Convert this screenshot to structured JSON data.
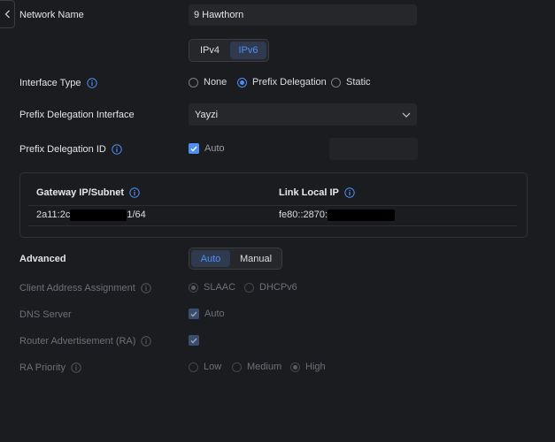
{
  "network_name": {
    "label": "Network Name",
    "value": "9 Hawthorn"
  },
  "ip_version": {
    "options": [
      "IPv4",
      "IPv6"
    ],
    "selected": "IPv6"
  },
  "interface_type": {
    "label": "Interface Type",
    "options": [
      "None",
      "Prefix Delegation",
      "Static"
    ],
    "selected": "Prefix Delegation"
  },
  "prefix_delegation_interface": {
    "label": "Prefix Delegation Interface",
    "value": "Yayzi"
  },
  "prefix_delegation_id": {
    "label": "Prefix Delegation ID",
    "auto_label": "Auto",
    "auto_checked": true,
    "value": ""
  },
  "status_table": {
    "gateway_header": "Gateway IP/Subnet",
    "link_local_header": "Link Local IP",
    "gateway_prefix": "2a11:2c",
    "gateway_suffix": "1/64",
    "link_local_prefix": "fe80::2870:"
  },
  "advanced": {
    "label": "Advanced",
    "options": [
      "Auto",
      "Manual"
    ],
    "selected": "Auto"
  },
  "client_address_assignment": {
    "label": "Client Address Assignment",
    "options": [
      "SLAAC",
      "DHCPv6"
    ],
    "selected": "SLAAC"
  },
  "dns_server": {
    "label": "DNS Server",
    "auto_label": "Auto",
    "checked": true
  },
  "router_advertisement": {
    "label": "Router Advertisement (RA)",
    "checked": true
  },
  "ra_priority": {
    "label": "RA Priority",
    "options": [
      "Low",
      "Medium",
      "High"
    ],
    "selected": "High"
  },
  "colors": {
    "accent": "#4f8ff5",
    "background": "#1b1c1f"
  }
}
